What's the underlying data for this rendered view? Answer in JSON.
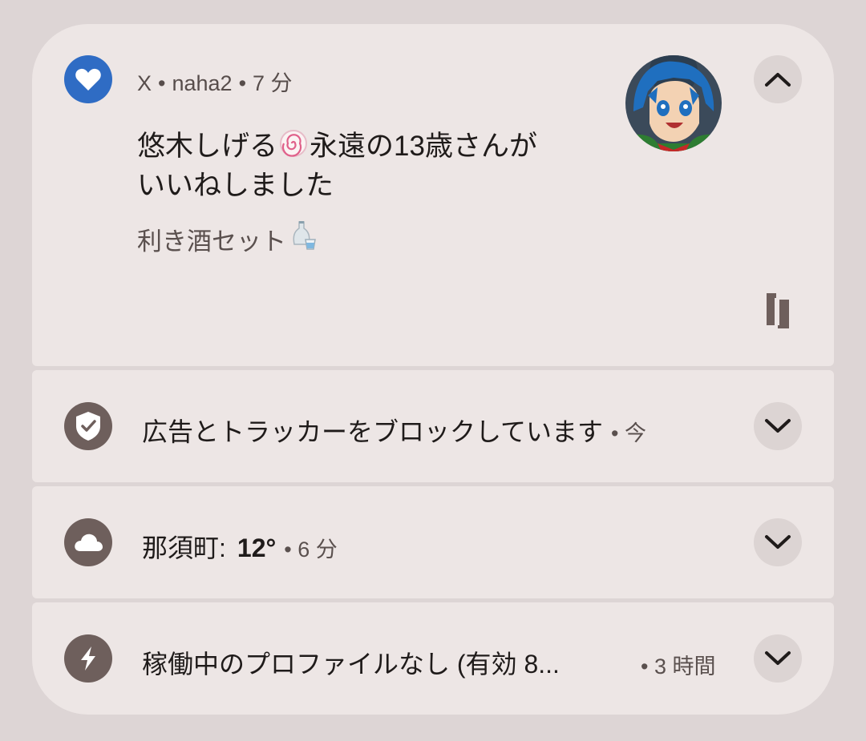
{
  "notification_x": {
    "app_name": "X",
    "account": "naha2",
    "time": "7 分",
    "title_part1": "悠木しげる",
    "title_part2": "永遠の13歳さんが",
    "title_part3": "いいねしました",
    "body": "利き酒セット",
    "icons": {
      "app": "heart-icon",
      "collapse": "chevron-up-icon",
      "copy": "copy-icon",
      "emoji1": "fishcake-emoji",
      "emoji2": "sake-emoji"
    },
    "colors": {
      "app_icon_bg": "#2f6cc4"
    }
  },
  "notification_adblock": {
    "text": "広告とトラッカーをブロックしています",
    "time": "今",
    "icons": {
      "app": "shield-check-icon",
      "expand": "chevron-down-icon"
    }
  },
  "notification_weather": {
    "location": "那須町:",
    "temperature": "12°",
    "time": "6 分",
    "icons": {
      "app": "cloud-icon",
      "expand": "chevron-down-icon"
    }
  },
  "notification_profile": {
    "text": "稼働中のプロファイルなし (有効 8...",
    "time": "3 時間",
    "icons": {
      "app": "lightning-icon",
      "expand": "chevron-down-icon"
    }
  },
  "separator": "•",
  "colors": {
    "background": "#ddd5d5",
    "card": "#ede6e5",
    "system_icon_bg": "#6e5f5c"
  }
}
